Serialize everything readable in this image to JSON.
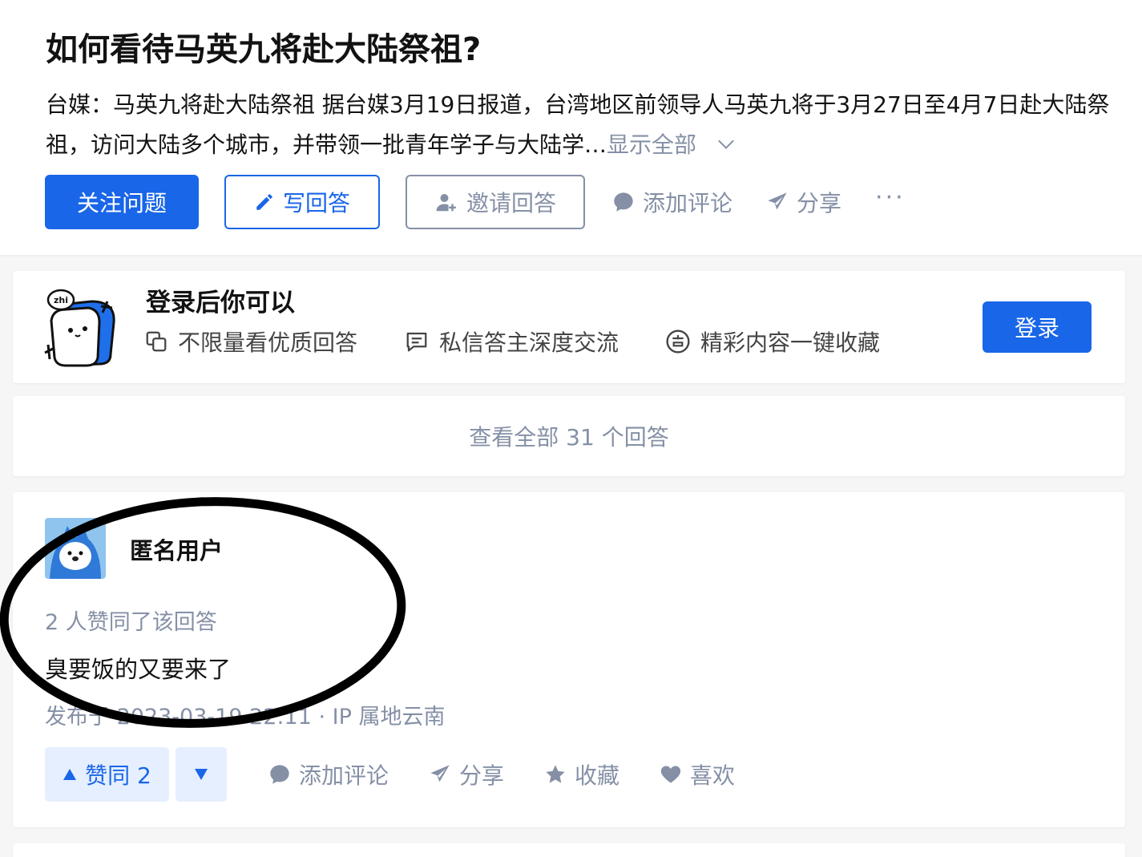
{
  "question": {
    "title": "如何看待马英九将赴大陆祭祖?",
    "excerpt": "台媒：马英九将赴大陆祭祖 据台媒3月19日报道，台湾地区前领导人马英九将于3月27日至4月7日赴大陆祭祖，访问大陆多个城市，并带领一批青年学子与大陆学…",
    "show_all": "显示全部"
  },
  "actions": {
    "follow": "关注问题",
    "write": "写回答",
    "invite": "邀请回答",
    "comment": "添加评论",
    "share": "分享",
    "more": "···"
  },
  "login_card": {
    "title": "登录后你可以",
    "benefits": [
      "不限量看优质回答",
      "私信答主深度交流",
      "精彩内容一键收藏"
    ],
    "login_button": "登录",
    "mascot_text": "zhi"
  },
  "view_all": "查看全部 31 个回答",
  "answer": {
    "author": "匿名用户",
    "votes_line": "2 人赞同了该回答",
    "content": "臭要饭的又要来了",
    "meta": "发布于 2023-03-19 22:11 · IP 属地云南",
    "vote_up": "赞同 2",
    "comment": "添加评论",
    "share": "分享",
    "collect": "收藏",
    "like": "喜欢"
  },
  "colors": {
    "brand": "#1966e8",
    "muted": "#8590a6",
    "vote_bg": "#e5efff"
  }
}
